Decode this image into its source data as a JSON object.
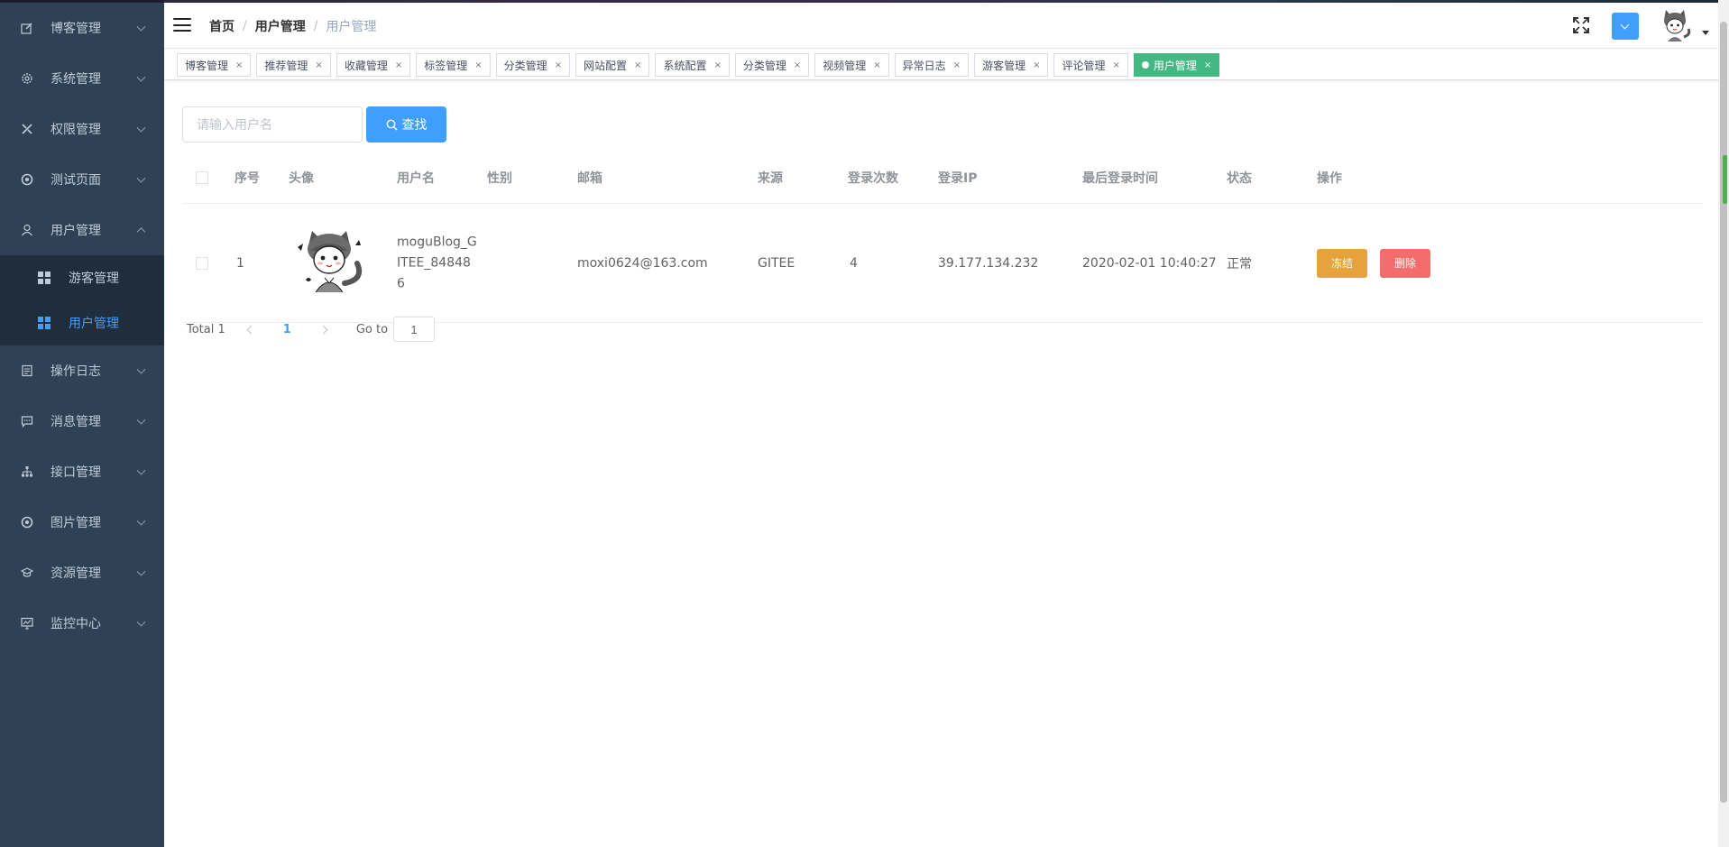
{
  "sidebar": {
    "items": [
      {
        "label": "博客管理",
        "icon": "edit-icon"
      },
      {
        "label": "系统管理",
        "icon": "gear-icon"
      },
      {
        "label": "权限管理",
        "icon": "tools-icon"
      },
      {
        "label": "测试页面",
        "icon": "target-icon"
      },
      {
        "label": "用户管理",
        "icon": "user-icon",
        "expanded": true
      },
      {
        "label": "操作日志",
        "icon": "log-icon"
      },
      {
        "label": "消息管理",
        "icon": "message-icon"
      },
      {
        "label": "接口管理",
        "icon": "sitemap-icon"
      },
      {
        "label": "图片管理",
        "icon": "target-icon"
      },
      {
        "label": "资源管理",
        "icon": "graduation-icon"
      },
      {
        "label": "监控中心",
        "icon": "monitor-icon"
      }
    ],
    "submenu": [
      {
        "label": "游客管理",
        "icon": "grid-icon"
      },
      {
        "label": "用户管理",
        "icon": "grid-icon",
        "active": true
      }
    ],
    "bg_color": "#304156",
    "active_color": "#409eff"
  },
  "header": {
    "breadcrumb": [
      "首页",
      "用户管理",
      "用户管理"
    ],
    "breadcrumb_separator": "/"
  },
  "tags": [
    {
      "label": "博客管理"
    },
    {
      "label": "推荐管理"
    },
    {
      "label": "收藏管理"
    },
    {
      "label": "标签管理"
    },
    {
      "label": "分类管理"
    },
    {
      "label": "网站配置"
    },
    {
      "label": "系统配置"
    },
    {
      "label": "分类管理"
    },
    {
      "label": "视频管理"
    },
    {
      "label": "异常日志"
    },
    {
      "label": "游客管理"
    },
    {
      "label": "评论管理"
    },
    {
      "label": "用户管理",
      "active": true
    }
  ],
  "tag_close": "×",
  "search": {
    "placeholder": "请输入用户名",
    "value": "",
    "button_label": "查找"
  },
  "table": {
    "columns": [
      "序号",
      "头像",
      "用户名",
      "性别",
      "邮箱",
      "来源",
      "登录次数",
      "登录IP",
      "最后登录时间",
      "状态",
      "操作"
    ],
    "rows": [
      {
        "index": "1",
        "username": "moguBlog_GITEE_848486",
        "gender": "",
        "email": "moxi0624@163.com",
        "source": "GITEE",
        "login_count": "4",
        "login_ip": "39.177.134.232",
        "last_login": "2020-02-01 10:40:27",
        "status": "正常",
        "actions": [
          "冻结",
          "删除"
        ]
      }
    ]
  },
  "pagination": {
    "total_label": "Total 1",
    "current_page": "1",
    "goto_label": "Go to",
    "goto_value": "1"
  },
  "colors": {
    "primary": "#409eff",
    "warning": "#e6a23c",
    "danger": "#f56c6c",
    "tag_active": "#42b983"
  }
}
